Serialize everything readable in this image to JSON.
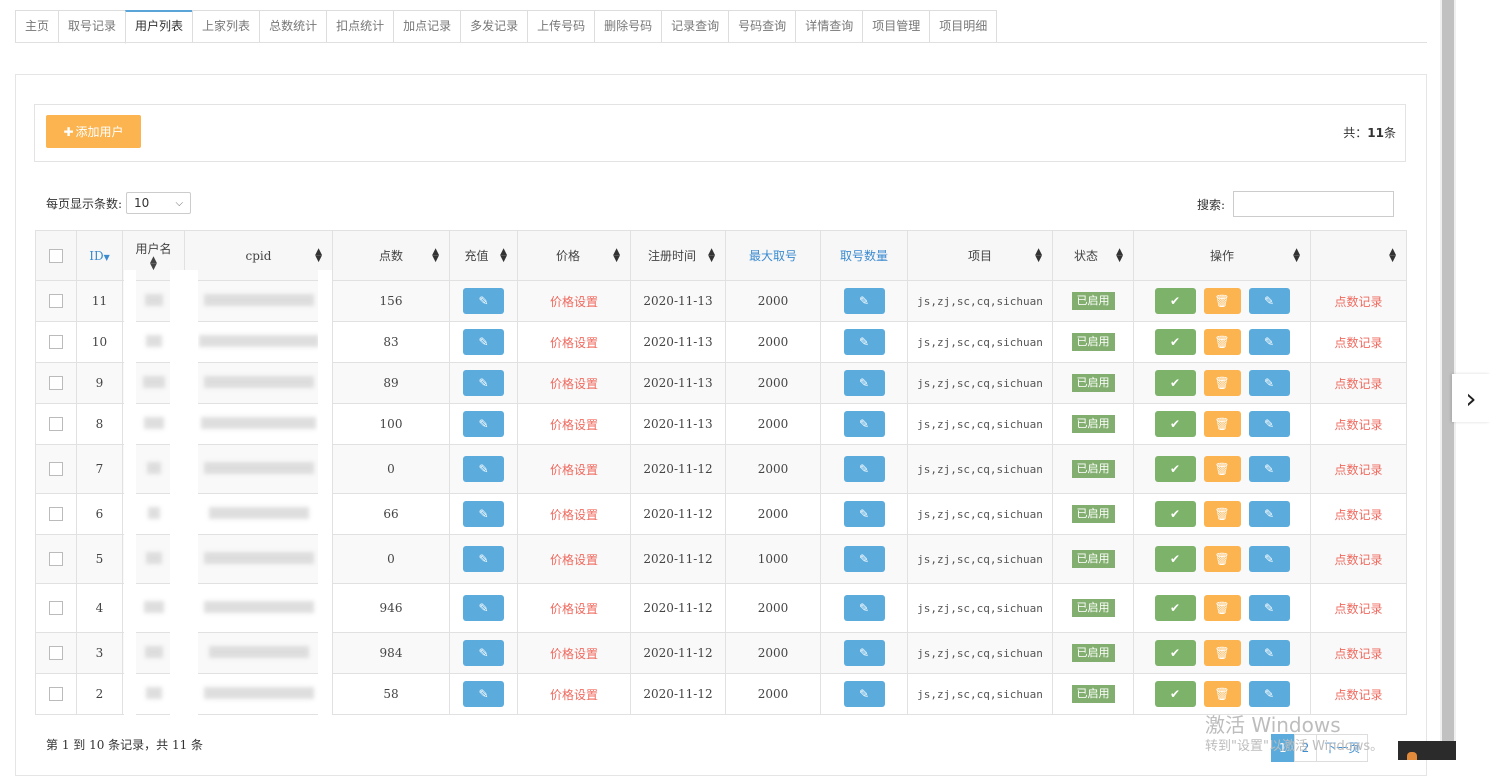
{
  "tabs": [
    "主页",
    "取号记录",
    "用户列表",
    "上家列表",
    "总数统计",
    "扣点统计",
    "加点记录",
    "多发记录",
    "上传号码",
    "删除号码",
    "记录查询",
    "号码查询",
    "详情查询",
    "项目管理",
    "项目明细"
  ],
  "active_tab": 2,
  "toolbar": {
    "add_label": "添加用户",
    "total_prefix": "共：",
    "total_count": "11",
    "total_suffix": "条"
  },
  "pagesize": {
    "label": "每页显示条数:",
    "value": "10"
  },
  "search": {
    "label": "搜索:"
  },
  "table": {
    "headers": [
      "",
      "ID",
      "用户名",
      "cpid",
      "点数",
      "充值",
      "价格",
      "注册时间",
      "最大取号",
      "取号数量",
      "项目",
      "状态",
      "操作",
      ""
    ],
    "price_link": "价格设置",
    "status_label": "已启用",
    "record_link": "点数记录",
    "rows": [
      {
        "id": "11",
        "points": "156",
        "date": "2020-11-13",
        "max": "2000",
        "project": "js,zj,sc,cq,sichuan"
      },
      {
        "id": "10",
        "points": "83",
        "date": "2020-11-13",
        "max": "2000",
        "project": "js,zj,sc,cq,sichuan"
      },
      {
        "id": "9",
        "points": "89",
        "date": "2020-11-13",
        "max": "2000",
        "project": "js,zj,sc,cq,sichuan"
      },
      {
        "id": "8",
        "points": "100",
        "date": "2020-11-13",
        "max": "2000",
        "project": "js,zj,sc,cq,sichuan"
      },
      {
        "id": "7",
        "points": "0",
        "date": "2020-11-12",
        "max": "2000",
        "project": "js,zj,sc,cq,sichuan"
      },
      {
        "id": "6",
        "points": "66",
        "date": "2020-11-12",
        "max": "2000",
        "project": "js,zj,sc,cq,sichuan"
      },
      {
        "id": "5",
        "points": "0",
        "date": "2020-11-12",
        "max": "1000",
        "project": "js,zj,sc,cq,sichuan"
      },
      {
        "id": "4",
        "points": "946",
        "date": "2020-11-12",
        "max": "2000",
        "project": "js,zj,sc,cq,sichuan"
      },
      {
        "id": "3",
        "points": "984",
        "date": "2020-11-12",
        "max": "2000",
        "project": "js,zj,sc,cq,sichuan"
      },
      {
        "id": "2",
        "points": "58",
        "date": "2020-11-12",
        "max": "2000",
        "project": "js,zj,sc,cq,sichuan"
      }
    ]
  },
  "footer": {
    "info": "第 1 到 10 条记录，共 11 条",
    "pages": [
      "1",
      "2",
      "下一页"
    ]
  },
  "watermark": {
    "line1": "激活 Windows",
    "line2": "转到\"设置\"以激活 Windows。"
  },
  "colors": {
    "primary": "#5bacdd",
    "warning": "#fbb450",
    "success": "#7db26a",
    "danger_link": "#f0695e"
  }
}
